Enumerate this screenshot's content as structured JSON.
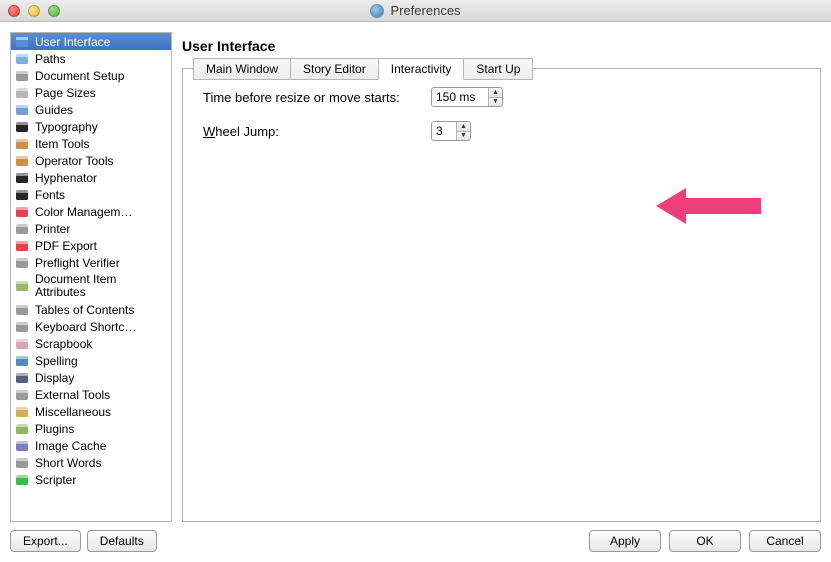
{
  "window": {
    "title": "Preferences"
  },
  "sidebar": {
    "items": [
      {
        "label": "User Interface",
        "icon": "window-icon",
        "selected": true
      },
      {
        "label": "Paths",
        "icon": "folder-icon"
      },
      {
        "label": "Document Setup",
        "icon": "doc-icon"
      },
      {
        "label": "Page Sizes",
        "icon": "page-icon"
      },
      {
        "label": "Guides",
        "icon": "guides-icon"
      },
      {
        "label": "Typography",
        "icon": "typography-icon"
      },
      {
        "label": "Item Tools",
        "icon": "tools-icon"
      },
      {
        "label": "Operator Tools",
        "icon": "tools-icon"
      },
      {
        "label": "Hyphenator",
        "icon": "hyphen-icon"
      },
      {
        "label": "Fonts",
        "icon": "font-icon"
      },
      {
        "label": "Color Managem…",
        "icon": "color-icon"
      },
      {
        "label": "Printer",
        "icon": "printer-icon"
      },
      {
        "label": "PDF Export",
        "icon": "pdf-icon"
      },
      {
        "label": "Preflight Verifier",
        "icon": "preflight-icon"
      },
      {
        "label": "Document Item Attributes",
        "icon": "attrs-icon",
        "multiline": true
      },
      {
        "label": "Tables of Contents",
        "icon": "toc-icon"
      },
      {
        "label": "Keyboard Shortc…",
        "icon": "keyboard-icon"
      },
      {
        "label": "Scrapbook",
        "icon": "scrapbook-icon"
      },
      {
        "label": "Spelling",
        "icon": "spelling-icon"
      },
      {
        "label": "Display",
        "icon": "display-icon"
      },
      {
        "label": "External Tools",
        "icon": "exttools-icon"
      },
      {
        "label": "Miscellaneous",
        "icon": "misc-icon"
      },
      {
        "label": "Plugins",
        "icon": "plugin-icon"
      },
      {
        "label": "Image Cache",
        "icon": "imagecache-icon"
      },
      {
        "label": "Short Words",
        "icon": "shortwords-icon"
      },
      {
        "label": "Scripter",
        "icon": "scripter-icon"
      }
    ],
    "export_label": "Export...",
    "defaults_label": "Defaults"
  },
  "main": {
    "title": "User Interface",
    "tabs": [
      {
        "label": "Main Window"
      },
      {
        "label": "Story Editor"
      },
      {
        "label": "Interactivity",
        "active": true
      },
      {
        "label": "Start Up"
      }
    ],
    "fields": {
      "resize_label": "Time before resize or move starts:",
      "resize_value": "150 ms",
      "wheel_label": "Wheel Jump:",
      "wheel_value": "3"
    },
    "buttons": {
      "apply": "Apply",
      "ok": "OK",
      "cancel": "Cancel"
    }
  },
  "annotation": {
    "color": "#ef3f7a"
  }
}
